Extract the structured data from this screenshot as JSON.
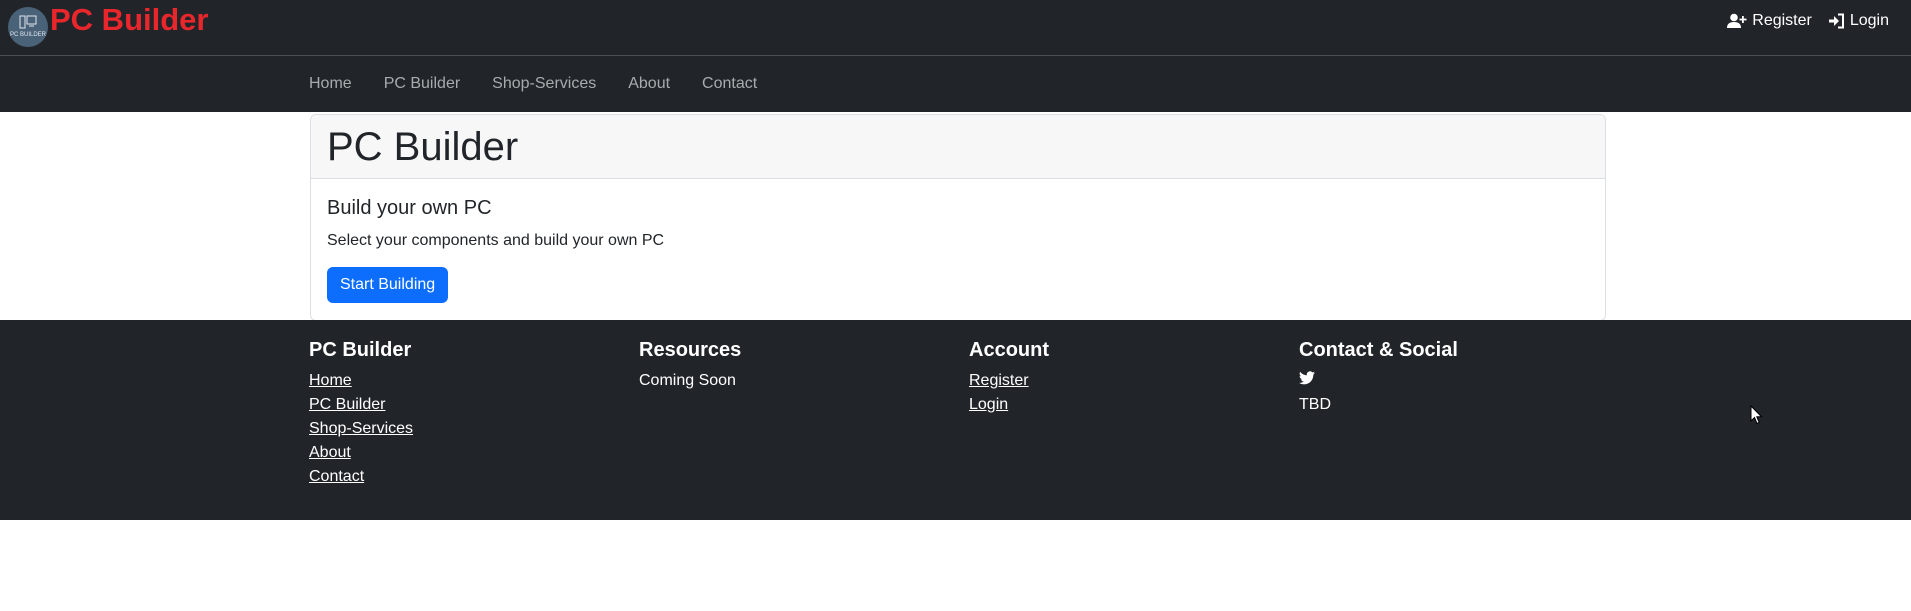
{
  "header": {
    "brand": "PC Builder",
    "logo_text": "PC BUILDER",
    "actions": [
      {
        "label": "Register",
        "icon": "user-plus-icon"
      },
      {
        "label": "Login",
        "icon": "sign-in-icon"
      }
    ]
  },
  "nav": {
    "items": [
      "Home",
      "PC Builder",
      "Shop-Services",
      "About",
      "Contact"
    ]
  },
  "card": {
    "header_title": "PC Builder",
    "title": "Build your own PC",
    "text": "Select your components and build your own PC",
    "button": "Start Building"
  },
  "footer": {
    "columns": [
      {
        "heading": "PC Builder",
        "links": [
          "Home",
          "PC Builder",
          "Shop-Services",
          "About",
          "Contact"
        ]
      },
      {
        "heading": "Resources",
        "text": "Coming Soon"
      },
      {
        "heading": "Account",
        "links": [
          "Register",
          "Login"
        ]
      },
      {
        "heading": "Contact & Social",
        "icon": "twitter-icon",
        "text": "TBD"
      }
    ]
  },
  "colors": {
    "dark": "#212529",
    "brand": "#e8262c",
    "primary": "#0d6efd",
    "nav_text": "#a8abae"
  }
}
